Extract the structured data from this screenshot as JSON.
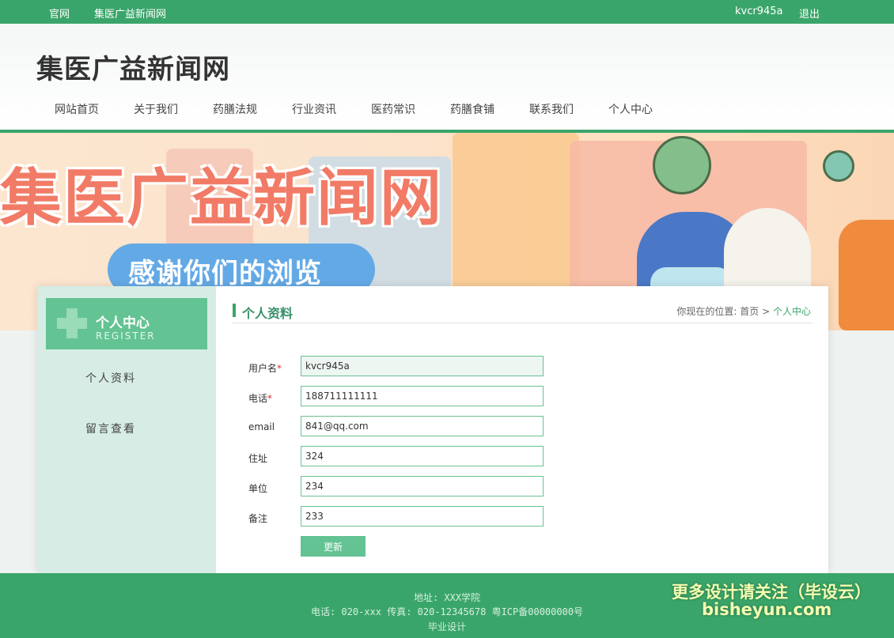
{
  "topbar": {
    "official": "官网",
    "site_link": "集医广益新闻网",
    "username": "kvcr945a",
    "logout": "退出"
  },
  "header": {
    "site_title": "集医广益新闻网"
  },
  "nav": {
    "items": [
      "网站首页",
      "关于我们",
      "药膳法规",
      "行业资讯",
      "医药常识",
      "药膳食铺",
      "联系我们",
      "个人中心"
    ]
  },
  "banner": {
    "title": "集医广益新闻网",
    "subtitle": "感谢你们的浏览"
  },
  "sidebar": {
    "title": "个人中心",
    "subtitle": "REGISTER",
    "items": [
      "个人资料",
      "留言查看"
    ]
  },
  "section": {
    "title": "个人资料",
    "breadcrumb_prefix": "你现在的位置:",
    "breadcrumb_home": "首页",
    "breadcrumb_sep": ">",
    "breadcrumb_current": "个人中心"
  },
  "form": {
    "fields": [
      {
        "label": "用户名",
        "required": "*",
        "value": "kvcr945a"
      },
      {
        "label": "电话",
        "required": "*",
        "value": "188711111111"
      },
      {
        "label": "email",
        "required": "",
        "value": "841@qq.com"
      },
      {
        "label": "住址",
        "required": "",
        "value": "324"
      },
      {
        "label": "单位",
        "required": "",
        "value": "234"
      },
      {
        "label": "备注",
        "required": "",
        "value": "233"
      }
    ],
    "submit_label": "更新"
  },
  "footer": {
    "address": "地址: XXX学院",
    "contact": "电话: 020-xxx 传真: 020-12345678 粤ICP备00000000号",
    "note": "毕业设计",
    "watermark_line1": "更多设计请关注（毕设云）",
    "watermark_line2": "bisheyun.com"
  },
  "colors": {
    "primary": "#3aa56a",
    "sidebar_bg": "#d6ece4",
    "banner_title": "#f17b66"
  }
}
